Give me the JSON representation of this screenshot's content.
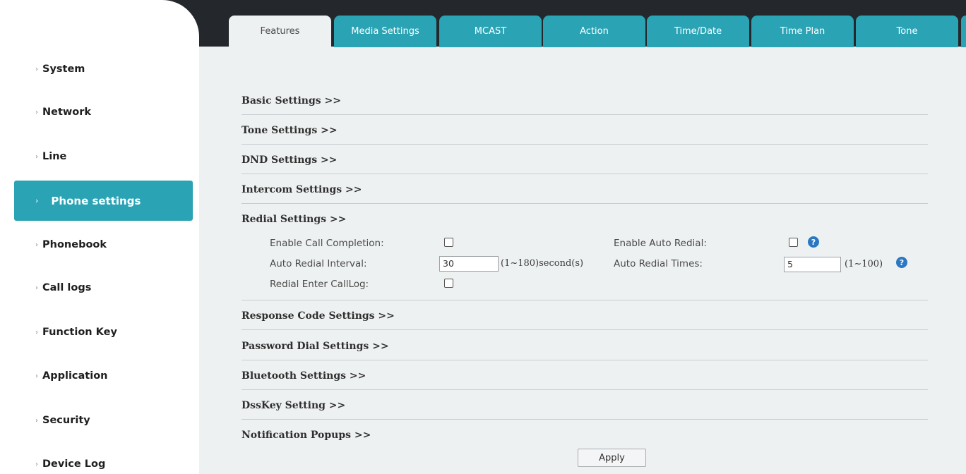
{
  "sidebar": {
    "items": [
      {
        "label": "System"
      },
      {
        "label": "Network"
      },
      {
        "label": "Line"
      },
      {
        "label": "Phone settings",
        "active": true
      },
      {
        "label": "Phonebook"
      },
      {
        "label": "Call logs"
      },
      {
        "label": "Function Key"
      },
      {
        "label": "Application"
      },
      {
        "label": "Security"
      },
      {
        "label": "Device Log"
      }
    ],
    "chevron": "›"
  },
  "tabs": [
    {
      "label": "Features",
      "active": true
    },
    {
      "label": "Media Settings"
    },
    {
      "label": "MCAST"
    },
    {
      "label": "Action"
    },
    {
      "label": "Time/Date"
    },
    {
      "label": "Time Plan"
    },
    {
      "label": "Tone"
    }
  ],
  "sections": [
    {
      "label": "Basic Settings >>"
    },
    {
      "label": "Tone Settings >>"
    },
    {
      "label": "DND Settings >>"
    },
    {
      "label": "Intercom Settings >>"
    },
    {
      "label": "Redial Settings >>"
    },
    {
      "label": "Response Code Settings >>"
    },
    {
      "label": "Password Dial Settings >>"
    },
    {
      "label": "Bluetooth Settings >>"
    },
    {
      "label": "DssKey Setting >>"
    },
    {
      "label": "Notification Popups >>"
    }
  ],
  "redial": {
    "enable_call_completion": {
      "label": "Enable Call Completion:",
      "checked": false
    },
    "enable_auto_redial": {
      "label": "Enable Auto Redial:",
      "checked": false
    },
    "auto_redial_interval": {
      "label": "Auto Redial Interval:",
      "value": "30",
      "hint": "(1~180)second(s)"
    },
    "auto_redial_times": {
      "label": "Auto Redial Times:",
      "value": "5",
      "hint": "(1~100)"
    },
    "redial_enter_calllog": {
      "label": "Redial Enter CallLog:",
      "checked": false
    },
    "help_glyph": "?"
  },
  "apply_label": "Apply",
  "colors": {
    "accent": "#2aa3b4",
    "topbar": "#24272b",
    "help": "#2b78c2"
  }
}
